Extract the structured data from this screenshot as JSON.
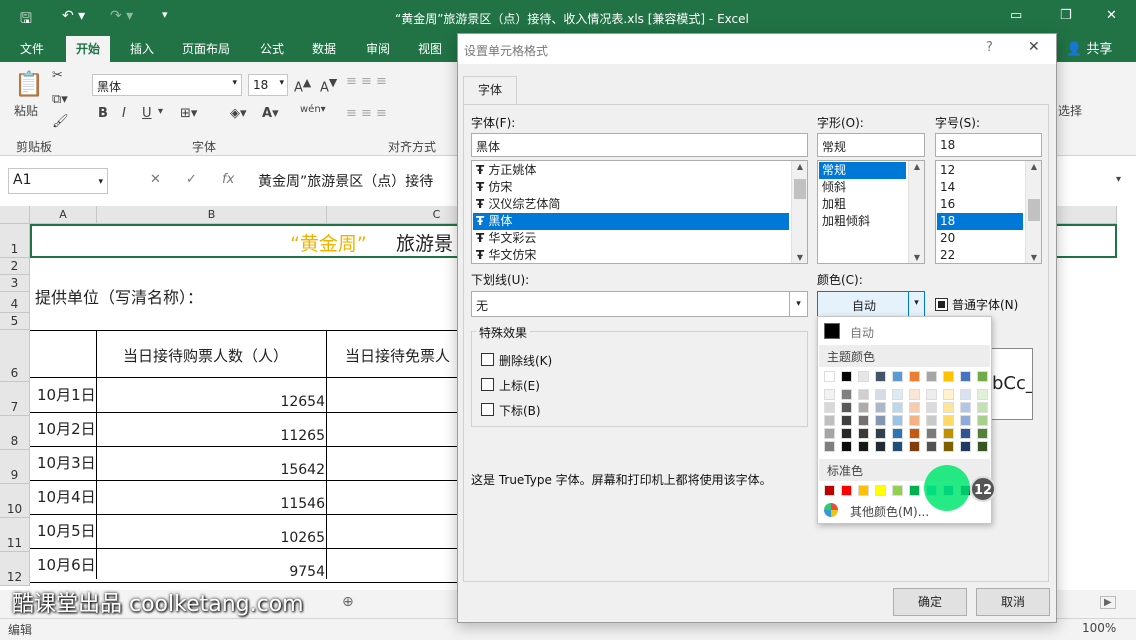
{
  "window": {
    "title": "“黄金周”旅游景区（点）接待、收入情况表.xls  [兼容模式] - Excel",
    "share_label": "共享",
    "select_label": "选择"
  },
  "ribbon": {
    "tabs": [
      "文件",
      "开始",
      "插入",
      "页面布局",
      "公式",
      "数据",
      "审阅",
      "视图"
    ],
    "active_tab": "开始",
    "font_name": "黑体",
    "font_size": "18",
    "paste_label": "粘贴",
    "clipboard_group": "剪贴板",
    "font_group": "字体",
    "alignment_group": "对齐方式",
    "bold": "B",
    "italic": "I",
    "underline": "U",
    "fontcolor": "A",
    "wrap": "wén"
  },
  "formula": {
    "name_box": "A1",
    "fx": "fx",
    "content": "黄金周”旅游景区（点）接待"
  },
  "sheet": {
    "columns": [
      "A",
      "B",
      "C"
    ],
    "rows": [
      "1",
      "2",
      "3",
      "4",
      "5",
      "6",
      "7",
      "8",
      "9",
      "10",
      "11",
      "12"
    ],
    "title_quoted": "“黄金周”",
    "title_rest": "旅游景",
    "provider": "提供单位（写清名称）：",
    "header_b": "当日接待购票人数（人）",
    "header_c": "当日接待免票人",
    "data": [
      {
        "date": "10月1日",
        "value": "12654"
      },
      {
        "date": "10月2日",
        "value": "11265"
      },
      {
        "date": "10月3日",
        "value": "15642"
      },
      {
        "date": "10月4日",
        "value": "11546"
      },
      {
        "date": "10月5日",
        "value": "10265"
      },
      {
        "date": "10月6日",
        "value": "9754"
      }
    ]
  },
  "status": {
    "mode": "编辑",
    "zoom": "100%"
  },
  "watermark": "酷课堂出品 coolketang.com",
  "dialog": {
    "title": "设置单元格格式",
    "help": "?",
    "close": "✕",
    "tab": "字体",
    "font_label": "字体(F):",
    "font_value": "黑体",
    "font_list": [
      "方正姚体",
      "仿宋",
      "汉仪综艺体简",
      "黑体",
      "华文彩云",
      "华文仿宋"
    ],
    "font_selected": "黑体",
    "style_label": "字形(O):",
    "style_value": "常规",
    "style_list": [
      "常规",
      "倾斜",
      "加粗",
      "加粗倾斜"
    ],
    "style_selected": "常规",
    "size_label": "字号(S):",
    "size_value": "18",
    "size_list": [
      "12",
      "14",
      "16",
      "18",
      "20",
      "22"
    ],
    "size_selected": "18",
    "underline_label": "下划线(U):",
    "underline_value": "无",
    "color_label": "颜色(C):",
    "color_value": "自动",
    "normal_font_label": "普通字体(N)",
    "effects_label": "特殊效果",
    "effects": [
      "删除线(K)",
      "上标(E)",
      "下标(B)"
    ],
    "preview_text": "bCc_",
    "note": "这是 TrueType 字体。屏幕和打印机上都将使用该字体。",
    "ok": "确定",
    "cancel": "取消"
  },
  "color_popup": {
    "auto_label": "自动",
    "theme_label": "主题颜色",
    "standard_label": "标准色",
    "more_label": "其他颜色(M)...",
    "theme_top": [
      "#ffffff",
      "#000000",
      "#e7e6e6",
      "#44546a",
      "#5b9bd5",
      "#ed7d31",
      "#a5a5a5",
      "#ffc000",
      "#4472c4",
      "#70ad47"
    ],
    "theme_shades": [
      [
        "#f2f2f2",
        "#7f7f7f",
        "#d0cece",
        "#d6dce4",
        "#deebf6",
        "#fbe5d5",
        "#ededed",
        "#fff2cc",
        "#d9e2f3",
        "#e2efd9"
      ],
      [
        "#d8d8d8",
        "#595959",
        "#aeabab",
        "#adb9ca",
        "#bdd7ee",
        "#f7cbac",
        "#dbdbdb",
        "#fee599",
        "#b4c6e7",
        "#c5e0b3"
      ],
      [
        "#bfbfbf",
        "#3f3f3f",
        "#757070",
        "#8496b0",
        "#9cc3e5",
        "#f4b183",
        "#c9c9c9",
        "#ffd965",
        "#8eaadb",
        "#a8d08d"
      ],
      [
        "#a5a5a5",
        "#262626",
        "#3a3838",
        "#323f4f",
        "#2e75b5",
        "#c55a11",
        "#7b7b7b",
        "#bf9000",
        "#2f5496",
        "#538135"
      ],
      [
        "#7f7f7f",
        "#0c0c0c",
        "#171616",
        "#222a35",
        "#1e4e79",
        "#833c0b",
        "#525252",
        "#7f6000",
        "#1f3864",
        "#375623"
      ]
    ],
    "standard": [
      "#c00000",
      "#ff0000",
      "#ffc000",
      "#ffff00",
      "#92d050",
      "#00b050",
      "#00b0f0",
      "#0070c0",
      "#002060",
      "#7030a0"
    ],
    "badge": "12"
  }
}
